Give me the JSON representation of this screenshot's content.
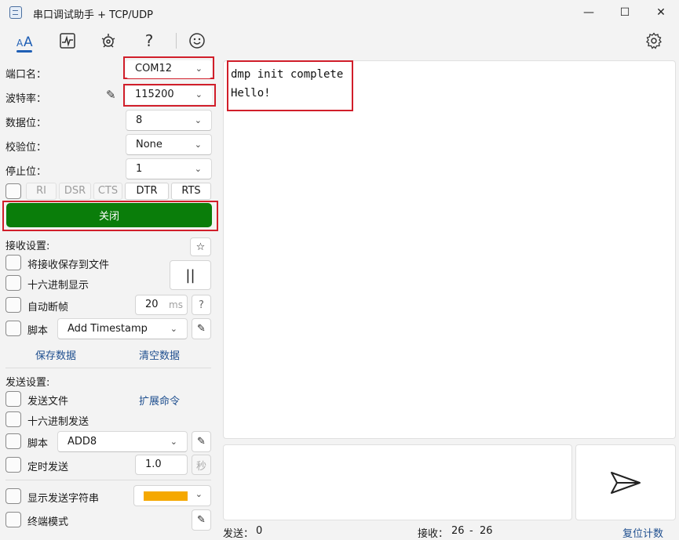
{
  "window": {
    "title": "串口调试助手 + TCP/UDP",
    "minimize": "—",
    "maximize": "☐",
    "close": "✕"
  },
  "toolbar": {
    "active_tool": "serial",
    "icons": [
      "serial-text-icon",
      "chart-icon",
      "plugin-icon",
      "help-icon",
      "smiley-icon",
      "settings-icon"
    ]
  },
  "serial": {
    "port_label": "端口名：",
    "port_value": "COM12",
    "baud_label": "波特率：",
    "baud_value": "115200",
    "databits_label": "数据位：",
    "databits_value": "8",
    "parity_label": "校验位：",
    "parity_value": "None",
    "stopbits_label": "停止位：",
    "stopbits_value": "1",
    "signals": [
      "RI",
      "DSR",
      "CTS",
      "DTR",
      "RTS"
    ],
    "toggle_label": "关闭",
    "toggle_color": "#0a7d0a"
  },
  "receive": {
    "section_label": "接收设置:",
    "save_to_file": "将接收保存到文件",
    "hex_display": "十六进制显示",
    "auto_frame": "自动断帧",
    "frame_ms_value": "20",
    "frame_ms_unit": "ms",
    "help_glyph": "?",
    "script_label": "脚本",
    "script_value": "Add Timestamp",
    "pause_glyph": "||",
    "star_glyph": "☆",
    "save_data": "保存数据",
    "clear_data": "清空数据",
    "lines": [
      "dmp init complete",
      "Hello!"
    ]
  },
  "send": {
    "section_label": "发送设置:",
    "send_file": "发送文件",
    "ext_cmd": "扩展命令",
    "hex_send": "十六进制发送",
    "script_label": "脚本",
    "script_value": "ADD8",
    "timed_send": "定时发送",
    "interval_value": "1.0",
    "interval_unit": "秒",
    "show_send_str": "显示发送字符串",
    "send_str_color": "#f5a800",
    "terminal_mode": "终端模式"
  },
  "statusbar": {
    "sent_label": "发送：",
    "sent_value": "0",
    "recv_label": "接收：",
    "recv_value": "26",
    "recv_sep": "-",
    "recv_value2": "26",
    "reset": "复位计数"
  }
}
